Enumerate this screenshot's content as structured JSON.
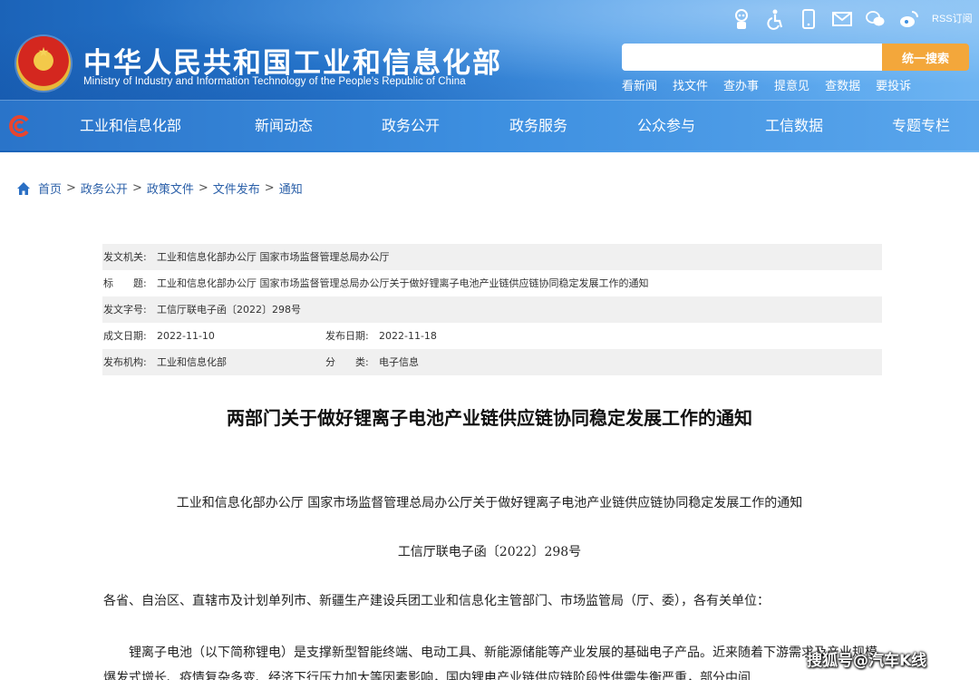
{
  "header": {
    "title": "中华人民共和国工业和信息化部",
    "subtitle": "Ministry of Industry and Information Technology of the People's Republic of China",
    "rss_label": "RSS订阅",
    "search": {
      "placeholder": "",
      "button_label": "统一搜索"
    },
    "quick_links": [
      "看新闻",
      "找文件",
      "查办事",
      "提意见",
      "查数据",
      "要投诉"
    ],
    "icons": [
      "robot-icon",
      "accessibility-icon",
      "mobile-icon",
      "mail-icon",
      "wechat-icon",
      "weibo-icon"
    ]
  },
  "nav": {
    "items": [
      "工业和信息化部",
      "新闻动态",
      "政务公开",
      "政务服务",
      "公众参与",
      "工信数据",
      "专题专栏"
    ]
  },
  "breadcrumb": {
    "items": [
      "首页",
      "政务公开",
      "政策文件",
      "文件发布",
      "通知"
    ],
    "separator": ">"
  },
  "meta": {
    "issuer_label": "发文机关:",
    "issuer": "工业和信息化部办公厅 国家市场监督管理总局办公厅",
    "title_label": "标　　题:",
    "title": "工业和信息化部办公厅 国家市场监督管理总局办公厅关于做好锂离子电池产业链供应链协同稳定发展工作的通知",
    "docno_label": "发文字号:",
    "docno": "工信厅联电子函〔2022〕298号",
    "created_label": "成文日期:",
    "created": "2022-11-10",
    "published_label": "发布日期:",
    "published": "2022-11-18",
    "org_label": "发布机构:",
    "org": "工业和信息化部",
    "category_label": "分　　类:",
    "category": "电子信息"
  },
  "article": {
    "title": "两部门关于做好锂离子电池产业链供应链协同稳定发展工作的通知",
    "heading": "工业和信息化部办公厅 国家市场监督管理总局办公厅关于做好锂离子电池产业链供应链协同稳定发展工作的通知",
    "number": "工信厅联电子函〔2022〕298号",
    "addressee": "各省、自治区、直辖市及计划单列市、新疆生产建设兵团工业和信息化主管部门、市场监管局（厅、委），各有关单位：",
    "paragraph": "锂离子电池（以下简称锂电）是支撑新型智能终端、电动工具、新能源储能等产业发展的基础电子产品。近来随着下游需求及产业规模爆发式增长、疫情复杂多变、经济下行压力加大等因素影响，国内锂电产业链供应链阶段性供需失衡严重，部分中间"
  },
  "watermark": "搜狐号@汽车K线",
  "colors": {
    "header_blue": "#2b7fd6",
    "search_button": "#f3a73b",
    "link_blue": "#2a5fa8",
    "meta_shade": "#f0f0f0"
  }
}
